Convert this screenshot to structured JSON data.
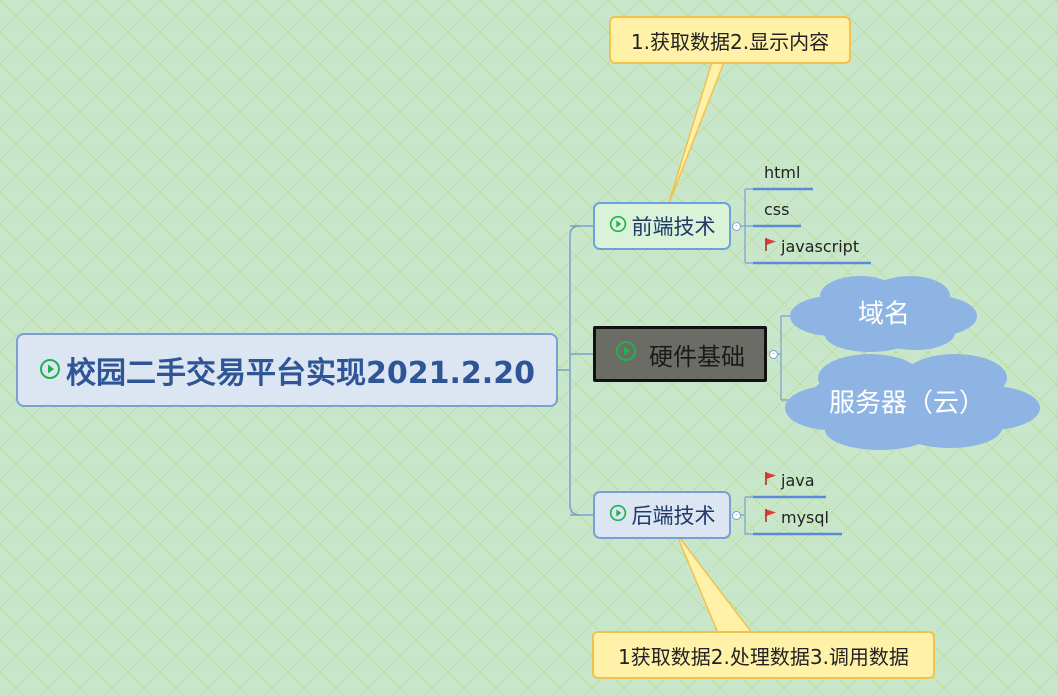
{
  "root": {
    "title": "校园二手交易平台实现2021.2.20"
  },
  "topics": {
    "front": {
      "label": "前端技术"
    },
    "hardware": {
      "label": "硬件基础"
    },
    "back": {
      "label": "后端技术"
    }
  },
  "front_items": [
    {
      "label": "html",
      "flag": false
    },
    {
      "label": "css",
      "flag": false
    },
    {
      "label": "javascript",
      "flag": true
    }
  ],
  "back_items": [
    {
      "label": "java",
      "flag": true
    },
    {
      "label": "mysql",
      "flag": true
    }
  ],
  "hardware_items": [
    {
      "label": "域名"
    },
    {
      "label": "服务器（云）"
    }
  ],
  "callouts": {
    "front": "1.获取数据2.显示内容",
    "back": "1获取数据2.处理数据3.调用数据"
  },
  "colors": {
    "background": "#c8e6c9",
    "topic_border": "#7b9fd3",
    "cloud": "#8eb4e3",
    "callout_fill": "#fff2a8",
    "flag": "#e53935",
    "play_icon": "#22b14c"
  },
  "icons": {
    "play": "play-circle-icon",
    "flag": "red-flag-icon"
  }
}
